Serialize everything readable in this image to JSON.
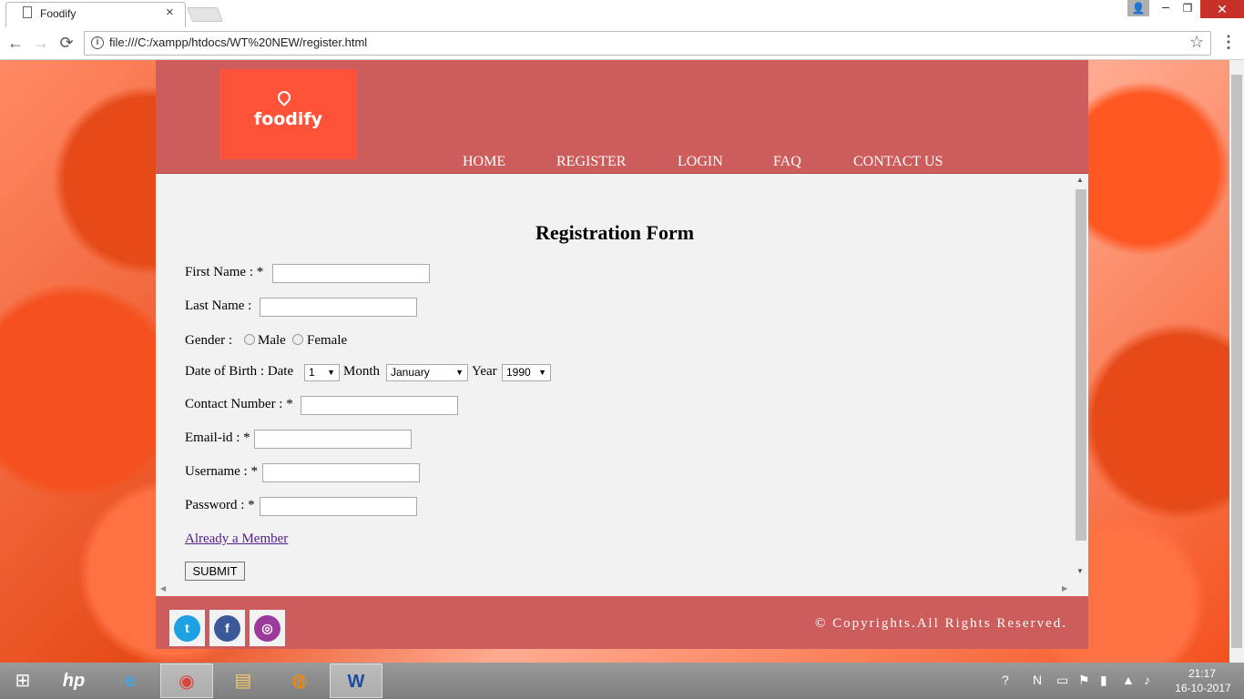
{
  "browser": {
    "tab_title": "Foodify",
    "tab_close": "×",
    "url": "file:///C:/xampp/htdocs/WT%20NEW/register.html",
    "back": "←",
    "forward": "→",
    "reload": "⟳",
    "star": "☆",
    "menu": "⋮",
    "info": "i",
    "window": {
      "user": "👤",
      "minimize": "–",
      "maximize": "❐",
      "close": "✕"
    }
  },
  "site": {
    "logo_text": "foodify",
    "nav": [
      "HOME",
      "REGISTER",
      "LOGIN",
      "FAQ",
      "CONTACT US"
    ],
    "form": {
      "title": "Registration Form",
      "first_name_label": "First Name : *",
      "last_name_label": "Last Name :",
      "gender_label": "Gender :",
      "male": "Male",
      "female": "Female",
      "dob_label": "Date of Birth : Date",
      "month_label": "Month",
      "year_label": "Year",
      "date_value": "1",
      "month_value": "January",
      "year_value": "1990",
      "contact_label": "Contact Number : *",
      "email_label": "Email-id : *",
      "username_label": "Username : *",
      "password_label": "Password : *",
      "already_link": "Already a Member",
      "submit": "SUBMIT"
    },
    "footer": {
      "copyright": "©  Copyrights.All Rights Reserved.",
      "social": {
        "twitter": "t",
        "facebook": "f",
        "instagram": "◎"
      }
    }
  },
  "taskbar": {
    "start": "⊞",
    "hp": "hp",
    "ie": "e",
    "chrome": "◉",
    "explorer": "▤",
    "firefox": "◍",
    "word": "W",
    "time": "21:17",
    "date": "16-10-2017"
  },
  "colors": {
    "header": "#cd5c5c",
    "logo_bg": "#fe5338",
    "twitter": "#1da1e2",
    "facebook": "#3b5998",
    "instagram": "#9b3a9b"
  }
}
